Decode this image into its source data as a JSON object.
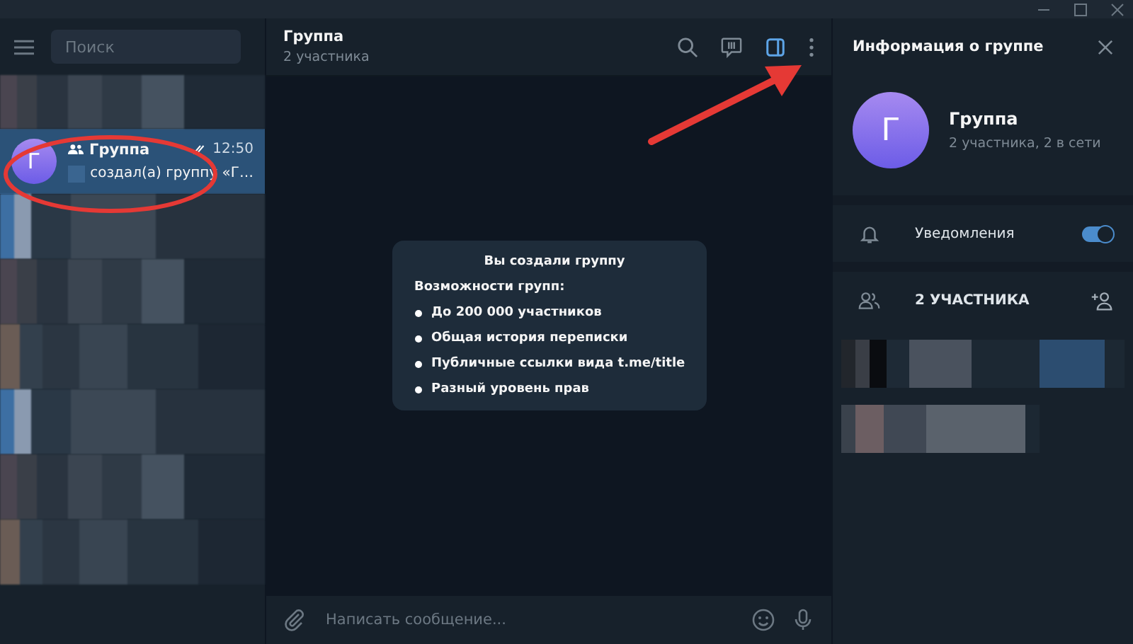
{
  "sidebar": {
    "search": {
      "placeholder": "Поиск"
    },
    "chats": [
      {
        "kind": "hidden"
      },
      {
        "kind": "chat",
        "selected": true,
        "avatar_letter": "Г",
        "name": "Группа",
        "time": "12:50",
        "preview": "создал(а) группу «Г…"
      },
      {
        "kind": "hidden"
      },
      {
        "kind": "hidden"
      },
      {
        "kind": "hidden"
      },
      {
        "kind": "hidden"
      },
      {
        "kind": "hidden"
      },
      {
        "kind": "hidden"
      }
    ]
  },
  "chat": {
    "title": "Группа",
    "subtitle": "2 участника",
    "info_card": {
      "title": "Вы создали группу",
      "heading": "Возможности групп:",
      "items": [
        "До 200 000 участников",
        "Общая история переписки",
        "Публичные ссылки вида t.me/title",
        "Разный уровень прав"
      ]
    },
    "composer": {
      "placeholder": "Написать сообщение..."
    }
  },
  "info_panel": {
    "title": "Информация о группе",
    "avatar_letter": "Г",
    "name": "Группа",
    "status": "2 участника, 2 в сети",
    "notifications": {
      "label": "Уведомления",
      "on": true
    },
    "members": {
      "label": "2 УЧАСТНИКА",
      "rows": [
        {
          "kind": "hidden"
        },
        {
          "kind": "hidden"
        }
      ]
    }
  }
}
